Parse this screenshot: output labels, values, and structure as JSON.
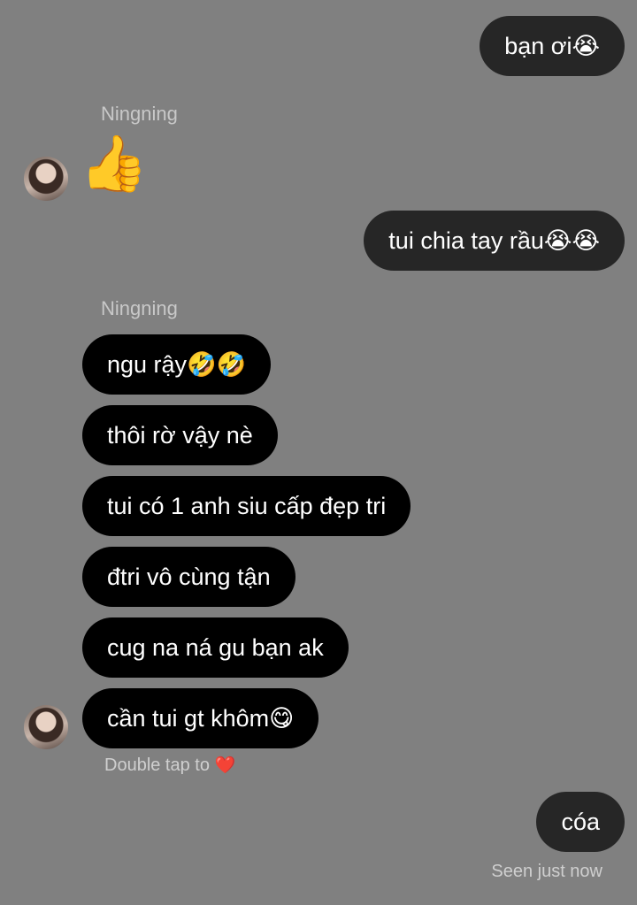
{
  "messages": {
    "m1": "bạn ơi😭",
    "m2_sender": "Ningning",
    "m2_emoji": "👍",
    "m3": "tui chia tay rầu😭😭",
    "m4_sender": "Ningning",
    "m4": "ngu rậy🤣🤣",
    "m5": "thôi rờ vậy nè",
    "m6": "tui có 1 anh siu cấp đẹp tri",
    "m7": "đtri vô cùng tận",
    "m8": "cug na ná gu bạn ak",
    "m9": "cần tui gt khôm😋",
    "m10": "cóa"
  },
  "status": {
    "double_tap": "Double tap to",
    "heart": "❤️",
    "seen": "Seen just now"
  },
  "colors": {
    "background": "#808080",
    "sent_bubble": "#262626",
    "received_bubble": "#000000"
  }
}
